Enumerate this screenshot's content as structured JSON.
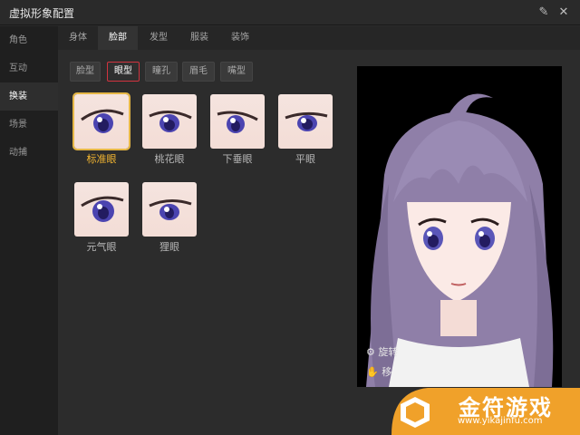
{
  "window": {
    "title": "虚拟形象配置"
  },
  "sidebar": {
    "items": [
      {
        "label": "角色"
      },
      {
        "label": "互动"
      },
      {
        "label": "换装"
      },
      {
        "label": "场景"
      },
      {
        "label": "动捕"
      }
    ]
  },
  "tabs": [
    {
      "label": "身体"
    },
    {
      "label": "脸部"
    },
    {
      "label": "发型"
    },
    {
      "label": "服装"
    },
    {
      "label": "装饰"
    }
  ],
  "subtabs": [
    {
      "label": "脸型"
    },
    {
      "label": "眼型"
    },
    {
      "label": "瞳孔"
    },
    {
      "label": "眉毛"
    },
    {
      "label": "嘴型"
    }
  ],
  "eyes": [
    {
      "label": "标准眼"
    },
    {
      "label": "桃花眼"
    },
    {
      "label": "下垂眼"
    },
    {
      "label": "平眼"
    },
    {
      "label": "元气眼"
    },
    {
      "label": "狸眼"
    }
  ],
  "selected_eye": "标准眼",
  "preview": {
    "caption1": "旋转",
    "caption2": "移"
  },
  "watermark": {
    "text": "金符游戏",
    "url": "www.yikajinfu.com"
  },
  "colors": {
    "accent": "#d1333f",
    "selected": "#f2b531",
    "hair": "#8f7fa8",
    "iris": "#5a56b8"
  }
}
